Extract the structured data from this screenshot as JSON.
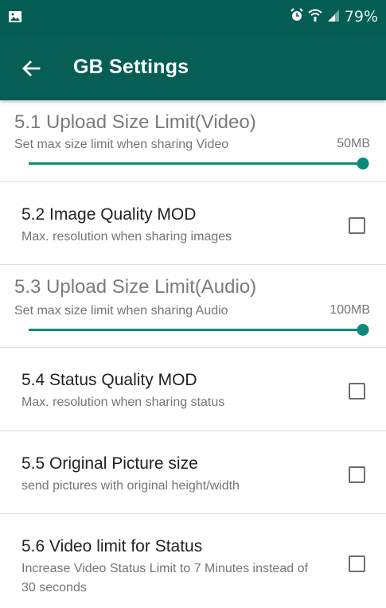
{
  "status_bar": {
    "left_icon": "image-icon",
    "alarm_icon": "alarm-icon",
    "wifi_icon": "wifi-icon",
    "signal_icon": "signal-icon",
    "battery": "79%"
  },
  "app_bar": {
    "back_icon": "arrow-back-icon",
    "title": "GB Settings"
  },
  "settings": [
    {
      "title": "5.1 Upload Size Limit(Video)",
      "summary": "Set max size limit when sharing Video",
      "value": "50MB",
      "type": "slider",
      "level": 1.0
    },
    {
      "title": "5.2 Image Quality MOD",
      "summary": "Max. resolution when sharing images",
      "type": "checkbox",
      "checked": false
    },
    {
      "title": "5.3 Upload Size Limit(Audio)",
      "summary": "Set max size limit when sharing Audio",
      "value": "100MB",
      "type": "slider",
      "level": 1.0
    },
    {
      "title": "5.4 Status Quality MOD",
      "summary": "Max. resolution when sharing status",
      "type": "checkbox",
      "checked": false
    },
    {
      "title": "5.5 Original Picture size",
      "summary": "send pictures with original height/width",
      "type": "checkbox",
      "checked": false
    },
    {
      "title": "5.6 Video limit for Status",
      "summary": "Increase Video Status Limit to 7 Minutes instead of 30 seconds",
      "type": "checkbox",
      "checked": false
    }
  ],
  "colors": {
    "status_bar": "#055e54",
    "app_bar": "#075e54",
    "accent": "#0b8a7a"
  }
}
